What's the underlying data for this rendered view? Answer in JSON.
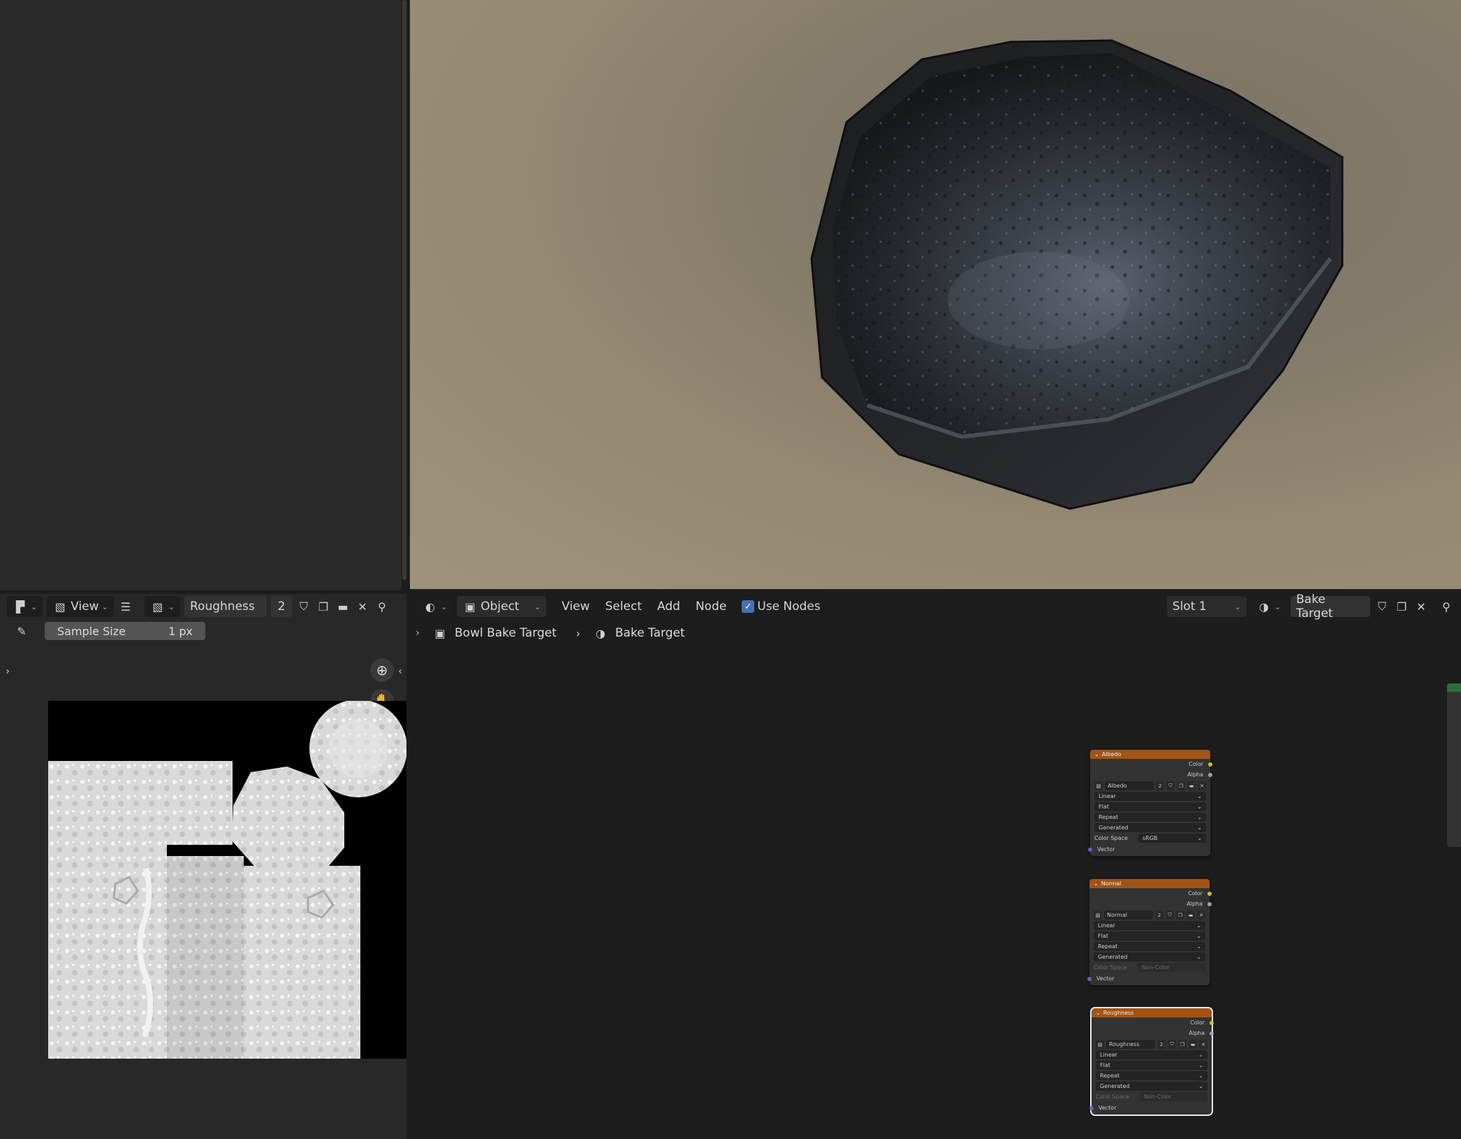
{
  "image_editor": {
    "view_label": "View",
    "image_name": "Roughness",
    "user_count": "2",
    "tool_option": {
      "label": "Sample Size",
      "value": "1 px"
    }
  },
  "node_editor": {
    "mode_label": "Object",
    "menu": [
      "View",
      "Select",
      "Add",
      "Node"
    ],
    "use_nodes_label": "Use Nodes",
    "slot_label": "Slot 1",
    "material_name": "Bake Target",
    "breadcrumb": {
      "object": "Bowl Bake Target",
      "material": "Bake Target"
    },
    "nodes": [
      {
        "title": "Albedo",
        "out_color": "Color",
        "out_alpha": "Alpha",
        "image": "Albedo",
        "users": "2",
        "interp": "Linear",
        "proj": "Flat",
        "ext": "Repeat",
        "source": "Generated",
        "cs_label": "Color Space",
        "cs_value": "sRGB",
        "in_vector": "Vector"
      },
      {
        "title": "Normal",
        "out_color": "Color",
        "out_alpha": "Alpha",
        "image": "Normal",
        "users": "2",
        "interp": "Linear",
        "proj": "Flat",
        "ext": "Repeat",
        "source": "Generated",
        "cs_label": "Color Space",
        "cs_value": "Non-Color",
        "in_vector": "Vector"
      },
      {
        "title": "Roughness",
        "out_color": "Color",
        "out_alpha": "Alpha",
        "image": "Roughness",
        "users": "2",
        "interp": "Linear",
        "proj": "Flat",
        "ext": "Repeat",
        "source": "Generated",
        "cs_label": "Color Space",
        "cs_value": "Non-Color",
        "in_vector": "Vector"
      }
    ]
  },
  "colors": {
    "node_header": "#a35415",
    "checkbox": "#4772b3",
    "socket_color": "#c7c729",
    "socket_vector": "#6363c7"
  }
}
